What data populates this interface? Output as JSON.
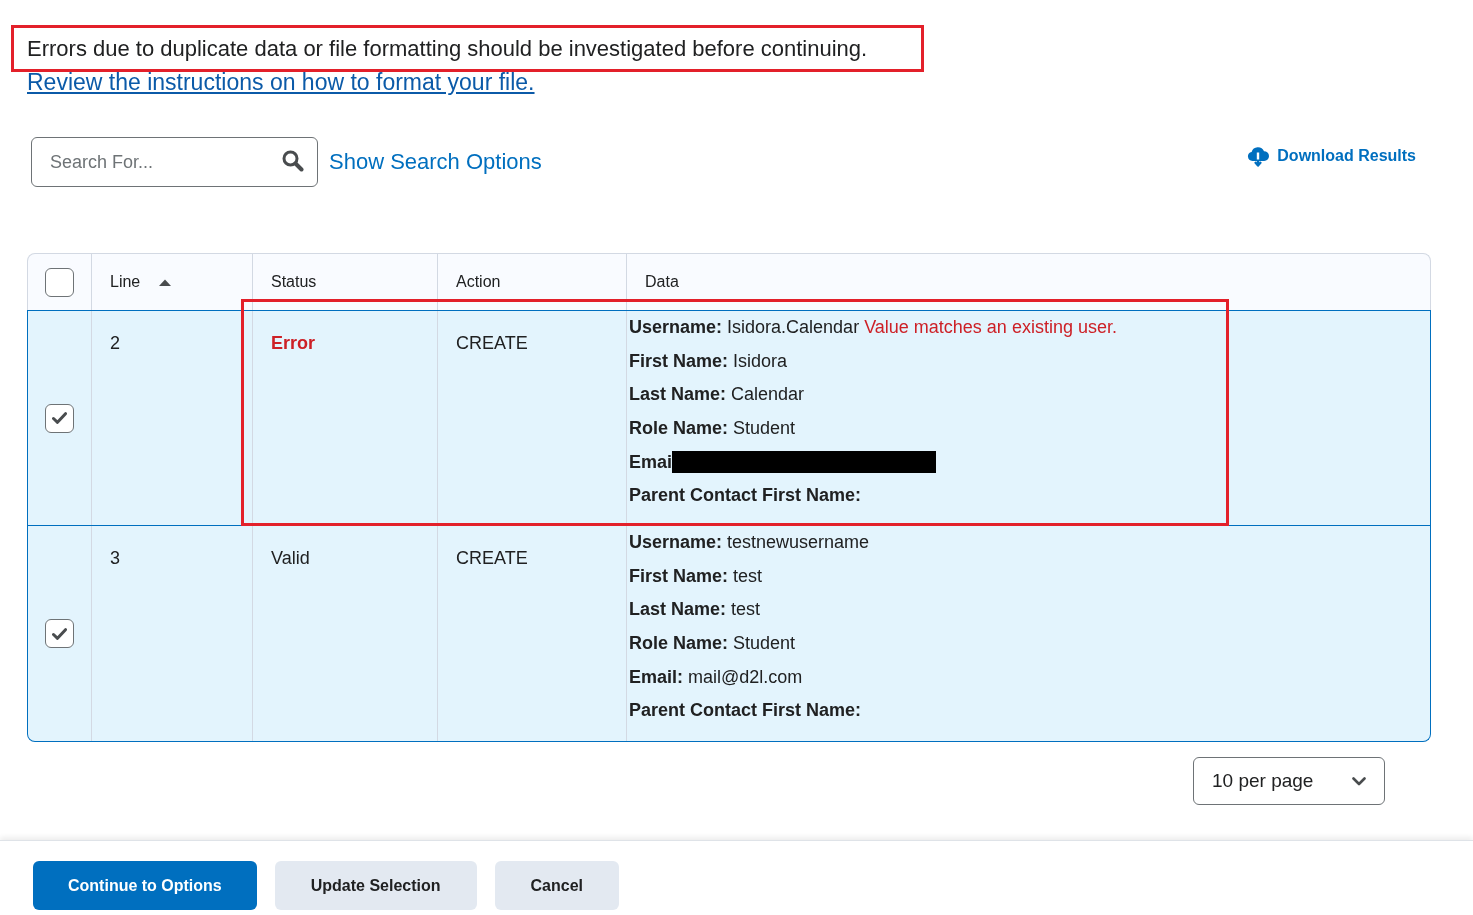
{
  "notice": {
    "text": "Errors due to duplicate data or file formatting should be investigated before continuing.",
    "highlighted": true
  },
  "instructions_link": {
    "text": "Review the instructions on how to format your file."
  },
  "search": {
    "placeholder": "Search For..."
  },
  "search_options_link": {
    "text": "Show Search Options"
  },
  "download_link": {
    "text": "Download Results"
  },
  "table": {
    "select_all": {
      "checked": false
    },
    "columns": [
      {
        "label": "Line",
        "sorted": true
      },
      {
        "label": "Status",
        "sorted": false
      },
      {
        "label": "Action",
        "sorted": false
      },
      {
        "label": "Data",
        "sorted": false
      }
    ],
    "rows": [
      {
        "checked": true,
        "highlighted": true,
        "line": "2",
        "status": {
          "text": "Error",
          "kind": "error"
        },
        "action": "CREATE",
        "data": [
          {
            "label": "Username:",
            "value": "Isidora.Calendar",
            "message": "Value matches an existing user."
          },
          {
            "label": "First Name:",
            "value": "Isidora"
          },
          {
            "label": "Last Name:",
            "value": "Calendar"
          },
          {
            "label": "Role Name:",
            "value": "Student"
          },
          {
            "label": "Emai",
            "redacted": true
          },
          {
            "label": "Parent Contact First Name:"
          }
        ]
      },
      {
        "checked": true,
        "highlighted": false,
        "line": "3",
        "status": {
          "text": "Valid",
          "kind": "valid"
        },
        "action": "CREATE",
        "data": [
          {
            "label": "Username:",
            "value": "testnewusername"
          },
          {
            "label": "First Name:",
            "value": "test"
          },
          {
            "label": "Last Name:",
            "value": "test"
          },
          {
            "label": "Role Name:",
            "value": "Student"
          },
          {
            "label": "Email:",
            "value": "mail@d2l.com"
          },
          {
            "label": "Parent Contact First Name:"
          }
        ]
      }
    ]
  },
  "pagination": {
    "page_size": "10 per page"
  },
  "footer": {
    "buttons": [
      {
        "label": "Continue to Options",
        "kind": "primary"
      },
      {
        "label": "Update Selection",
        "kind": "secondary"
      },
      {
        "label": "Cancel",
        "kind": "secondary"
      }
    ]
  }
}
